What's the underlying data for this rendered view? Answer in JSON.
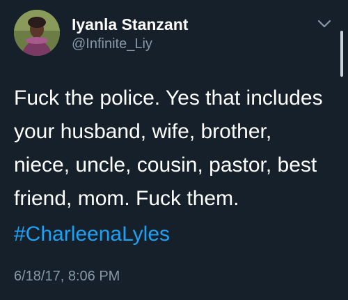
{
  "user": {
    "display_name": "Iyanla Stanzant",
    "handle": "@Infinite_Liy"
  },
  "tweet": {
    "lines": [
      "Fuck the police. Yes that includes",
      "your husband, wife, brother,",
      "niece, uncle, cousin, pastor, best",
      "friend, mom. Fuck them."
    ],
    "hashtag": "#CharleenaLyles",
    "timestamp": "6/18/17, 8:06 PM"
  },
  "icons": {
    "menu": "chevron-down-icon",
    "avatar": "profile-avatar"
  },
  "colors": {
    "background": "#15202b",
    "primary_text": "#ffffff",
    "secondary_text": "#8899a6",
    "link": "#1da1f2"
  }
}
